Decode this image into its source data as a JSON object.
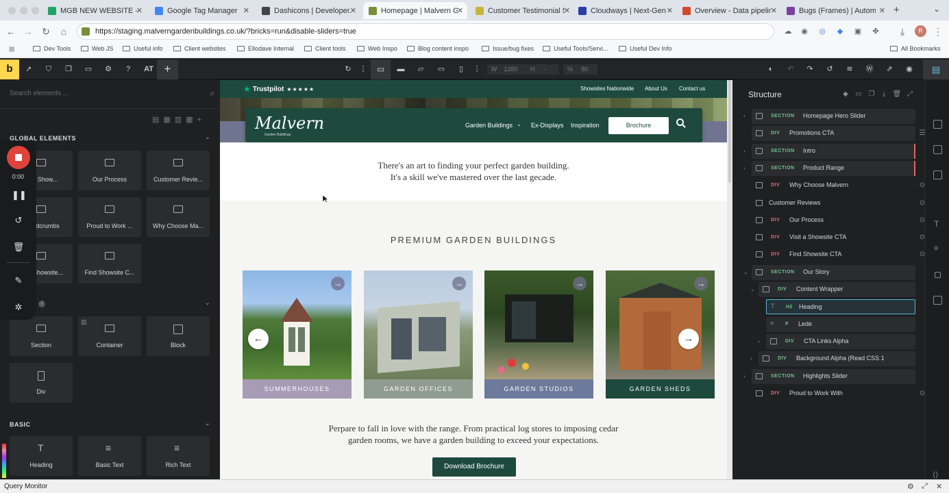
{
  "browser": {
    "tabs": [
      {
        "label": "MGB NEW WEBSITE - Go",
        "color": "#1fa463",
        "active": false
      },
      {
        "label": "Google Tag Manager",
        "color": "#4285f4",
        "active": false
      },
      {
        "label": "Dashicons | Developer.W",
        "color": "#444444",
        "active": false
      },
      {
        "label": "Homepage | Malvern Gar",
        "color": "#7a8f3a",
        "active": true
      },
      {
        "label": "Customer Testimonial Sli",
        "color": "#c9b43a",
        "active": false
      },
      {
        "label": "Cloudways | Next-Gen C",
        "color": "#2e3ea8",
        "active": false
      },
      {
        "label": "Overview - Data pipeline",
        "color": "#d24a2a",
        "active": false
      },
      {
        "label": "Bugs (Frames) | Automat",
        "color": "#7b3fa0",
        "active": false
      }
    ],
    "url": "https://staging.malverngardenbuildings.co.uk/?bricks=run&disable-sliders=true",
    "bookmarks": [
      "Dev Tools",
      "Web JS",
      "Useful info",
      "Client websites",
      "Ellodave Internal",
      "Client tools",
      "Web Inspo",
      "Blog content inspo",
      "Issue/bug fixes",
      "Useful Tools/Servi...",
      "Useful Dev Info"
    ],
    "all_bookmarks": "All Bookmarks",
    "profile_initial": "R"
  },
  "toolbar": {
    "logo": "b",
    "at_label": "AT",
    "width_label": "W",
    "width_value": "1280",
    "height_label": "H",
    "height_value": "-",
    "zoom_label": "%",
    "zoom_value": "80"
  },
  "left_panel": {
    "search_placeholder": "Search elements ...",
    "sections": {
      "global": "GLOBAL ELEMENTS",
      "basic": "BASIC"
    },
    "global_elements": [
      "Visit Show...",
      "Our Process",
      "Customer Revie...",
      "Breadcrumbs",
      "Proud to Work ...",
      "Why Choose Ma...",
      "Find Showsite...",
      "Find Showsite C..."
    ],
    "layout_elements": [
      "Section",
      "Container",
      "Block",
      "Div"
    ],
    "basic_elements": [
      "Heading",
      "Basic Text",
      "Rich Text"
    ]
  },
  "recorder": {
    "time": "0:00"
  },
  "canvas": {
    "trustpilot": "Trustpilot",
    "trustpilot_stars": "★★★★★",
    "toplinks": [
      "Showsites Nationwide",
      "About Us",
      "Contact us"
    ],
    "logo": "Malvern",
    "logo_sub": "Garden Buildings",
    "nav": [
      "Garden Buildings",
      "Ex-Displays",
      "Inspiration"
    ],
    "brochure_btn": "Brochure",
    "intro_line1": "There's an art to finding your perfect garden building.",
    "intro_line2": "It's a skill we've mastered over the last gecade.",
    "section_title": "PREMIUM GARDEN BUILDINGS",
    "cards": [
      {
        "label": "SUMMERHOUSES",
        "color": "#a79bb5"
      },
      {
        "label": "GARDEN OFFICES",
        "color": "#8f9c8f"
      },
      {
        "label": "GARDEN STUDIOS",
        "color": "#6d7a9c"
      },
      {
        "label": "GARDEN SHEDS",
        "color": "#1d4a3d"
      }
    ],
    "prep_line1": "Perpare to fall in love with the range. From practical log stores to imposing cedar",
    "prep_line2": "garden rooms, we have a garden building to exceed your expectations.",
    "download_btn": "Download Brochure"
  },
  "structure": {
    "title": "Structure",
    "rows": [
      {
        "tag": "SECTION",
        "name": "Homepage Hero Slider",
        "type": "section"
      },
      {
        "tag": "DIV",
        "name": "Promotions CTA",
        "type": "div-green"
      },
      {
        "tag": "SECTION",
        "name": "Intro",
        "type": "section"
      },
      {
        "tag": "SECTION",
        "name": "Product Range",
        "type": "section"
      },
      {
        "tag": "DIV",
        "name": "Why Choose Malvern",
        "type": "div"
      },
      {
        "tag": "",
        "name": "Customer Reviews",
        "type": "plain"
      },
      {
        "tag": "DIV",
        "name": "Our Process",
        "type": "div"
      },
      {
        "tag": "DIV",
        "name": "Visit a Showsite CTA",
        "type": "div"
      },
      {
        "tag": "DIV",
        "name": "Find Showsite CTA",
        "type": "div"
      },
      {
        "tag": "SECTION",
        "name": "Our Story",
        "type": "section"
      },
      {
        "tag": "DIV",
        "name": "Content Wrapper",
        "type": "div-green"
      },
      {
        "tag": "H2",
        "name": "Heading",
        "type": "h2"
      },
      {
        "tag": "P",
        "name": "Lede",
        "type": "p"
      },
      {
        "tag": "DIV",
        "name": "CTA Links Alpha",
        "type": "div-green"
      },
      {
        "tag": "DIV",
        "name": "Background Alpha (Read CSS 1",
        "type": "div-green"
      },
      {
        "tag": "SECTION",
        "name": "Highlights Slider",
        "type": "section"
      },
      {
        "tag": "DIV",
        "name": "Proud to Work With",
        "type": "div"
      }
    ]
  },
  "statusbar": "Query Monitor"
}
